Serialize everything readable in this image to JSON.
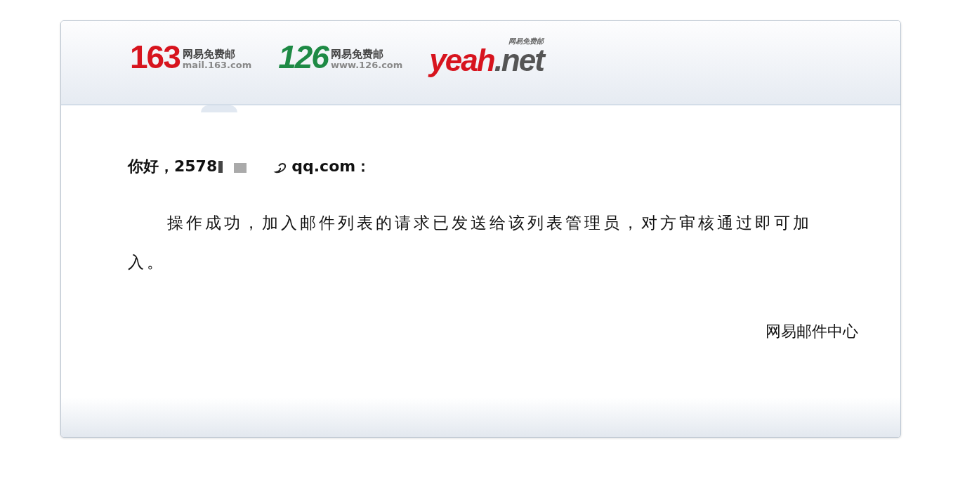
{
  "brands": [
    {
      "kind": "stacked",
      "number": "163",
      "caption": "网易免费邮",
      "domain": "mail.163.com",
      "color": "#d7141e",
      "selected": true
    },
    {
      "kind": "stacked",
      "number": "126",
      "caption": "网易免费邮",
      "domain": "www.126.com",
      "color": "#1e8a45",
      "selected": false
    },
    {
      "kind": "wordmark",
      "word": "yeah",
      "suffix": ".net",
      "caption": "网易免费邮",
      "color": "#d7141e",
      "selected": false
    }
  ],
  "greeting": {
    "prefix": "你好，2578",
    "suffix": "qq.com："
  },
  "message": "操作成功，加入邮件列表的请求已发送给该列表管理员，对方审核通过即可加入。",
  "signature": "网易邮件中心"
}
